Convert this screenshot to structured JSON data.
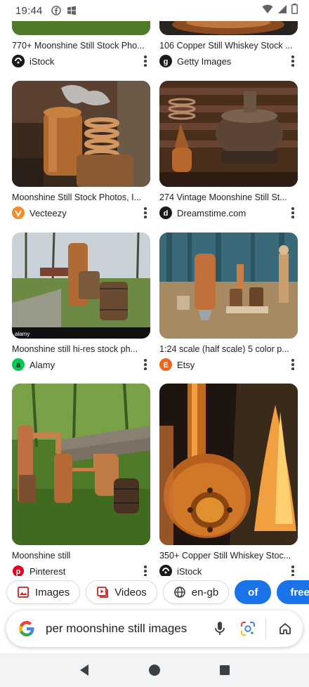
{
  "status_bar": {
    "time": "19:44",
    "icons": [
      "facebook-icon",
      "windows-icon",
      "wifi-icon",
      "signal-icon",
      "battery-icon"
    ]
  },
  "results": [
    {
      "caption": "770+ Moonshine Still Stock Pho...",
      "source": "iStock",
      "logo_letter": "iS",
      "logo_color": "#1a1a1a"
    },
    {
      "caption": "106 Copper Still Whiskey Stock ...",
      "source": "Getty Images",
      "logo_letter": "G",
      "logo_color": "#1a1a1a"
    },
    {
      "caption": "Moonshine Still Stock Photos, I...",
      "source": "Vecteezy",
      "logo_letter": "V",
      "logo_color": "#f28c28"
    },
    {
      "caption": "274 Vintage Moonshine Still St...",
      "source": "Dreamstime.com",
      "logo_letter": "d",
      "logo_color": "#1a1a1a"
    },
    {
      "caption": "Moonshine still hi-res stock ph...",
      "source": "Alamy",
      "logo_letter": "a",
      "logo_color": "#00c853"
    },
    {
      "caption": "1:24 scale (half scale) 5 color p...",
      "source": "Etsy",
      "logo_letter": "E",
      "logo_color": "#f1641e"
    },
    {
      "caption": "Moonshine still",
      "source": "Pinterest",
      "logo_letter": "P",
      "logo_color": "#e60023"
    },
    {
      "caption": "350+ Copper Still Whiskey Stoc...",
      "source": "iStock",
      "logo_letter": "iS",
      "logo_color": "#1a1a1a"
    }
  ],
  "chips": {
    "images": "Images",
    "videos": "Videos",
    "lang": "en-gb",
    "of": "of",
    "free": "free"
  },
  "search": {
    "query": "per moonshine still images"
  },
  "colors": {
    "accent": "#1a73e8"
  }
}
